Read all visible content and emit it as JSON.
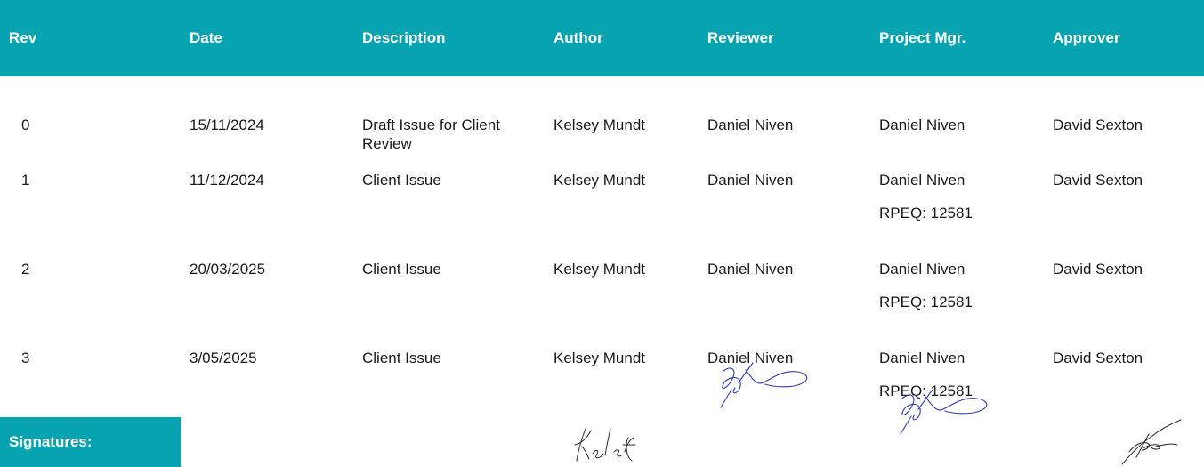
{
  "headers": [
    "Rev",
    "Date",
    "Description",
    "Author",
    "Reviewer",
    "Project Mgr.",
    "Approver"
  ],
  "rows": [
    {
      "rev": "0",
      "date": "15/11/2024",
      "description": "Draft Issue for Client Review",
      "author": "Kelsey Mundt",
      "reviewer": "Daniel Niven",
      "project_mgr": "Daniel Niven",
      "project_mgr_sub": "",
      "approver": "David Sexton"
    },
    {
      "rev": "1",
      "date": "11/12/2024",
      "description": "Client Issue",
      "author": "Kelsey Mundt",
      "reviewer": "Daniel Niven",
      "project_mgr": "Daniel Niven",
      "project_mgr_sub": "RPEQ: 12581",
      "approver": "David Sexton"
    },
    {
      "rev": "2",
      "date": "20/03/2025",
      "description": "Client Issue",
      "author": "Kelsey Mundt",
      "reviewer": "Daniel Niven",
      "project_mgr": "Daniel Niven",
      "project_mgr_sub": "RPEQ: 12581",
      "approver": "David Sexton"
    },
    {
      "rev": "3",
      "date": "3/05/2025",
      "description": "Client Issue",
      "author": "Kelsey Mundt",
      "reviewer": "Daniel Niven",
      "project_mgr": "Daniel Niven",
      "project_mgr_sub": "RPEQ: 12581",
      "approver": "David Sexton"
    }
  ],
  "signatures_label": "Signatures:",
  "colors": {
    "header_bg": "#07a3b0",
    "header_text": "#ffffff",
    "signature_ink": "#2f3db0"
  }
}
